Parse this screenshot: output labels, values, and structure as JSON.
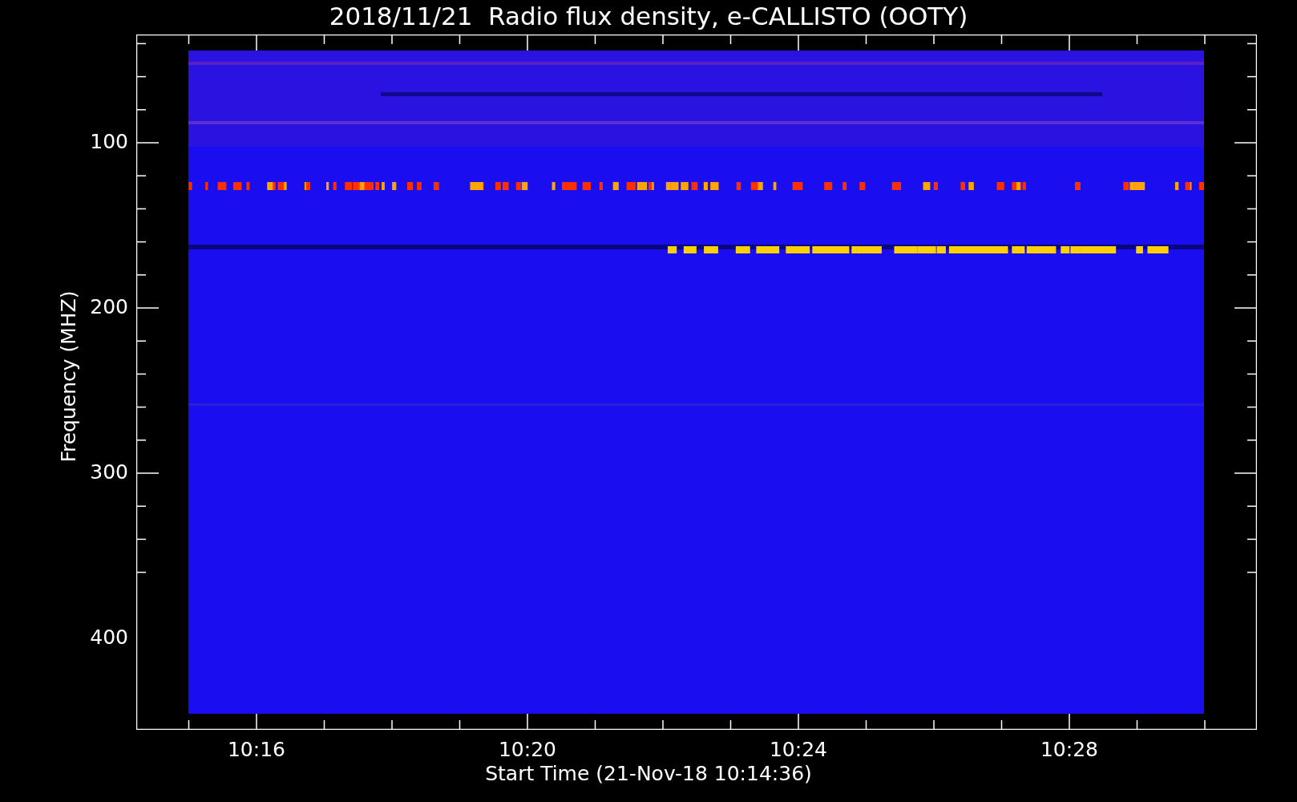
{
  "title": "2018/11/21  Radio flux density, e-CALLISTO (OOTY)",
  "y_axis": {
    "label": "Frequency (MHZ)",
    "ticks": [
      "100",
      "200",
      "300",
      "400"
    ]
  },
  "x_axis": {
    "label": "Start Time (21-Nov-18 10:14:36)",
    "ticks": [
      "10:16",
      "10:20",
      "10:24",
      "10:28"
    ]
  }
}
